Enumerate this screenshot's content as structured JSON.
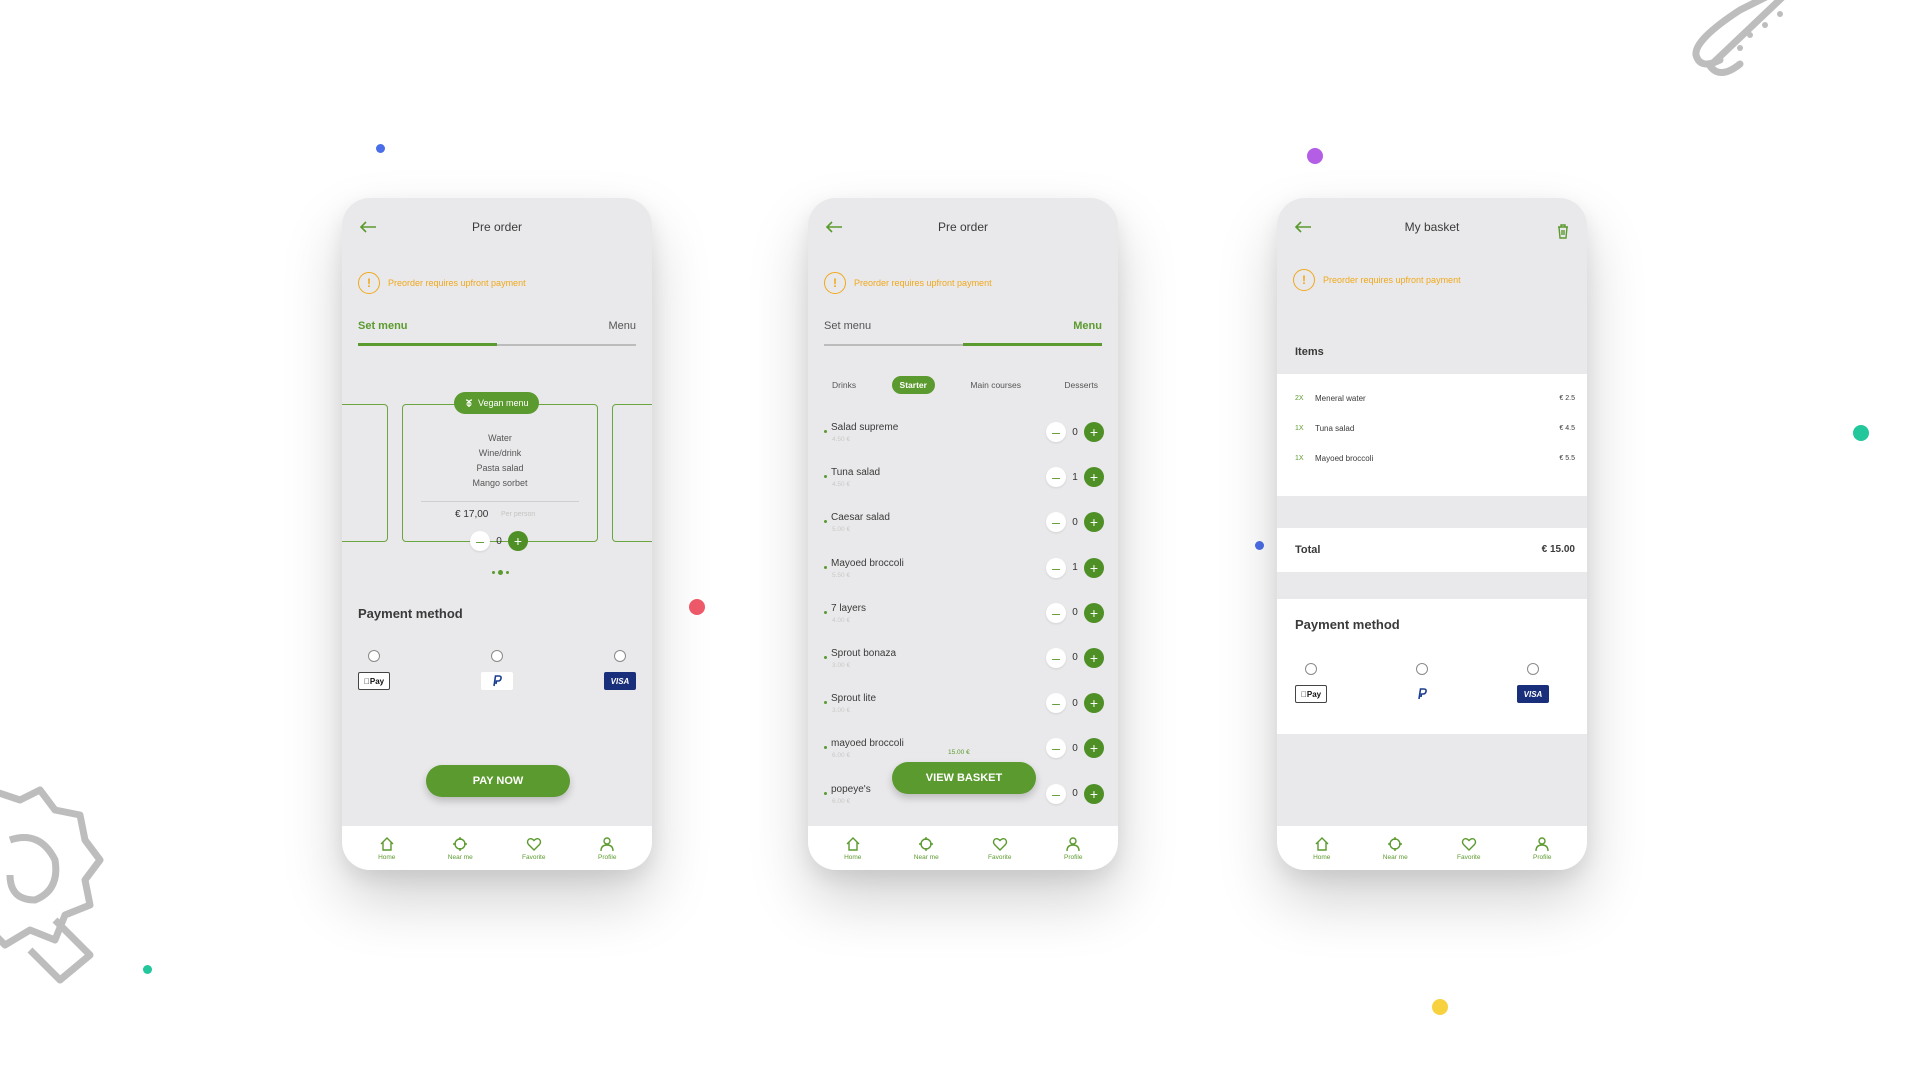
{
  "colors": {
    "accent": "#5b9a2e",
    "warning": "#f0a81b"
  },
  "screen1": {
    "title": "Pre order",
    "notice": "Preorder requires upfront payment",
    "seg_left": "Set menu",
    "seg_right": "Menu",
    "vegan_badge": "Vegan menu",
    "menu_items": [
      "Water",
      "Wine/drink",
      "Pasta salad",
      "Mango sorbet"
    ],
    "price": "€  17,00",
    "price_note": "Per person",
    "qty": "0",
    "payment_title": "Payment method",
    "pay_options": [
      "Pay",
      "PayPal",
      "VISA"
    ],
    "pay_button": "PAY NOW"
  },
  "screen2": {
    "title": "Pre order",
    "notice": "Preorder requires upfront payment",
    "seg_left": "Set menu",
    "seg_right": "Menu",
    "categories": [
      "Drinks",
      "Starter",
      "Main courses",
      "Desserts"
    ],
    "items": [
      {
        "name": "Salad supreme",
        "price": "4.50 €",
        "qty": "0"
      },
      {
        "name": "Tuna salad",
        "price": "4.50 €",
        "qty": "1"
      },
      {
        "name": "Caesar salad",
        "price": "5.00 €",
        "qty": "0"
      },
      {
        "name": "Mayoed broccoli",
        "price": "5.50 €",
        "qty": "1"
      },
      {
        "name": "7 layers",
        "price": "4.00 €",
        "qty": "0"
      },
      {
        "name": "Sprout bonaza",
        "price": "3.00 €",
        "qty": "0"
      },
      {
        "name": "Sprout lite",
        "price": "3.00 €",
        "qty": "0"
      },
      {
        "name": "mayoed broccoli",
        "price": "6.00 €",
        "qty": "0"
      },
      {
        "name": "popeye's",
        "price": "6.00 €",
        "qty": "0"
      }
    ],
    "basket_total": "15.00 €",
    "basket_button": "VIEW BASKET"
  },
  "screen3": {
    "title": "My basket",
    "notice": "Preorder requires upfront payment",
    "items_title": "Items",
    "items": [
      {
        "qty": "2X",
        "name": "Meneral water",
        "price": "€ 2.5"
      },
      {
        "qty": "1X",
        "name": "Tuna salad",
        "price": "€ 4.5"
      },
      {
        "qty": "1X",
        "name": "Mayoed broccoli",
        "price": "€ 5.5"
      }
    ],
    "total_label": "Total",
    "total_value": "€ 15.00",
    "payment_title": "Payment method",
    "pay_options": [
      "Pay",
      "PayPal",
      "VISA"
    ]
  },
  "tabbar": [
    "Home",
    "Near me",
    "Favorite",
    "Profile"
  ]
}
